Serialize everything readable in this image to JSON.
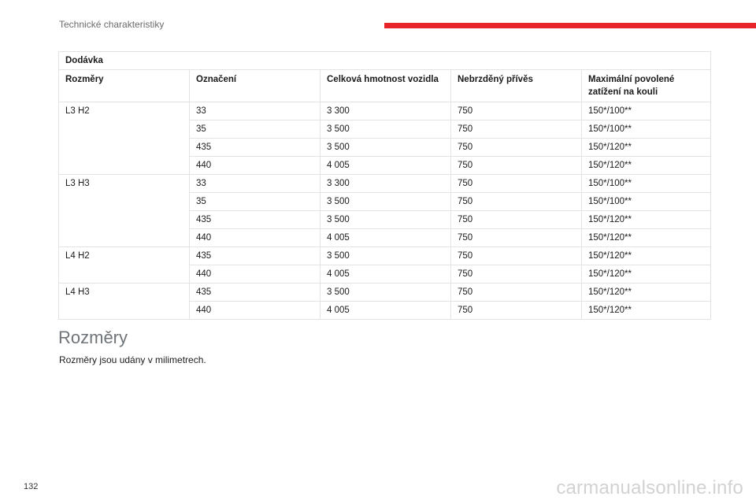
{
  "header": {
    "title": "Technické charakteristiky",
    "accent_color": "#e8242b"
  },
  "table": {
    "caption": "Dodávka",
    "columns": [
      "Rozměry",
      "Označení",
      "Celková hmotnost vozidla",
      "Nebrzděný přívěs",
      "Maximální povolené zatížení na kouli"
    ],
    "groups": [
      {
        "dimension": "L3 H2",
        "rows": [
          [
            "33",
            "3 300",
            "750",
            "150*/100**"
          ],
          [
            "35",
            "3 500",
            "750",
            "150*/100**"
          ],
          [
            "435",
            "3 500",
            "750",
            "150*/120**"
          ],
          [
            "440",
            "4 005",
            "750",
            "150*/120**"
          ]
        ]
      },
      {
        "dimension": "L3 H3",
        "rows": [
          [
            "33",
            "3 300",
            "750",
            "150*/100**"
          ],
          [
            "35",
            "3 500",
            "750",
            "150*/100**"
          ],
          [
            "435",
            "3 500",
            "750",
            "150*/120**"
          ],
          [
            "440",
            "4 005",
            "750",
            "150*/120**"
          ]
        ]
      },
      {
        "dimension": "L4 H2",
        "rows": [
          [
            "435",
            "3 500",
            "750",
            "150*/120**"
          ],
          [
            "440",
            "4 005",
            "750",
            "150*/120**"
          ]
        ]
      },
      {
        "dimension": "L4 H3",
        "rows": [
          [
            "435",
            "3 500",
            "750",
            "150*/120**"
          ],
          [
            "440",
            "4 005",
            "750",
            "150*/120**"
          ]
        ]
      }
    ]
  },
  "section": {
    "heading": "Rozměry",
    "text": "Rozměry jsou udány v milimetrech."
  },
  "page_number": "132",
  "watermark": "carmanualsonline.info"
}
